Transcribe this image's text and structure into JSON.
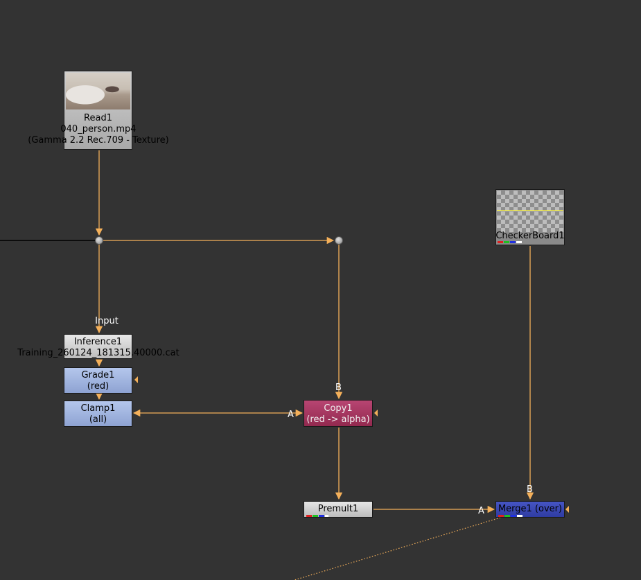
{
  "nodes": {
    "read": {
      "name": "Read1",
      "file": "040_person.mp4",
      "colorspace": "(Gamma 2.2 Rec.709 - Texture)"
    },
    "inference": {
      "name": "Inference1",
      "model": "Training_260124_181315.40000.cat",
      "input_label": "Input"
    },
    "grade": {
      "name": "Grade1",
      "channels": "(red)"
    },
    "clamp": {
      "name": "Clamp1",
      "channels": "(all)"
    },
    "copy": {
      "name": "Copy1",
      "op": "(red -> alpha)",
      "input_a": "A",
      "input_b": "B"
    },
    "checkerboard": {
      "name": "CheckerBoard1"
    },
    "premult": {
      "name": "Premult1"
    },
    "merge": {
      "name": "Merge1 (over)",
      "input_a": "A",
      "input_b": "B"
    }
  },
  "colors": {
    "background": "#333333",
    "pipe": "#f4b05a",
    "grade_node": "#9fb3dd",
    "copy_node": "#a3365f",
    "merge_node": "#3a48b6",
    "channel_red": "#e02020",
    "channel_green": "#20c020",
    "channel_blue": "#2030e0",
    "channel_white": "#ffffff"
  }
}
